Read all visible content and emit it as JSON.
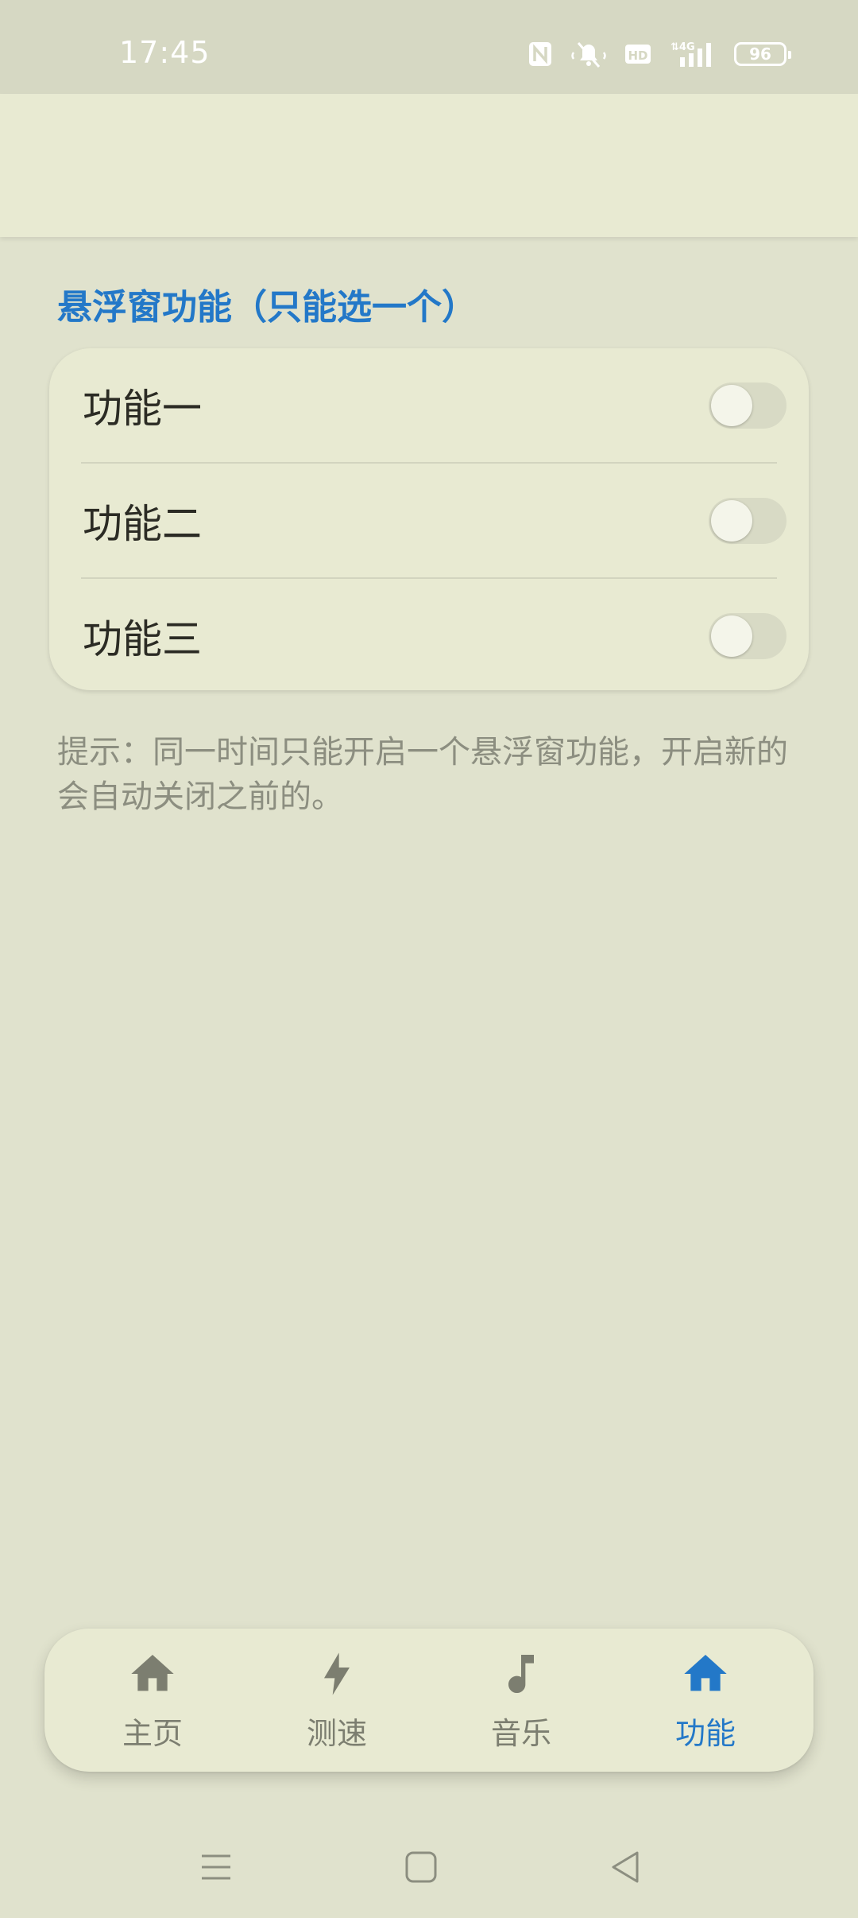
{
  "status_bar": {
    "time": "17:45",
    "battery": "96",
    "icons": [
      "nfc-icon",
      "mute-icon",
      "hd-icon",
      "4g-signal-icon",
      "battery-icon"
    ]
  },
  "section": {
    "title": "悬浮窗功能（只能选一个）"
  },
  "features": [
    {
      "label": "功能一",
      "enabled": false
    },
    {
      "label": "功能二",
      "enabled": false
    },
    {
      "label": "功能三",
      "enabled": false
    }
  ],
  "hint": "提示：同一时间只能开启一个悬浮窗功能，开启新的会自动关闭之前的。",
  "bottom_nav": {
    "items": [
      {
        "label": "主页",
        "icon": "home-icon",
        "active": false
      },
      {
        "label": "测速",
        "icon": "lightning-icon",
        "active": false
      },
      {
        "label": "音乐",
        "icon": "music-note-icon",
        "active": false
      },
      {
        "label": "功能",
        "icon": "home-icon",
        "active": true
      }
    ]
  },
  "colors": {
    "accent": "#2378c8",
    "background": "#e0e2cd",
    "surface": "#e8ead2",
    "inactive": "#7c7e70"
  }
}
